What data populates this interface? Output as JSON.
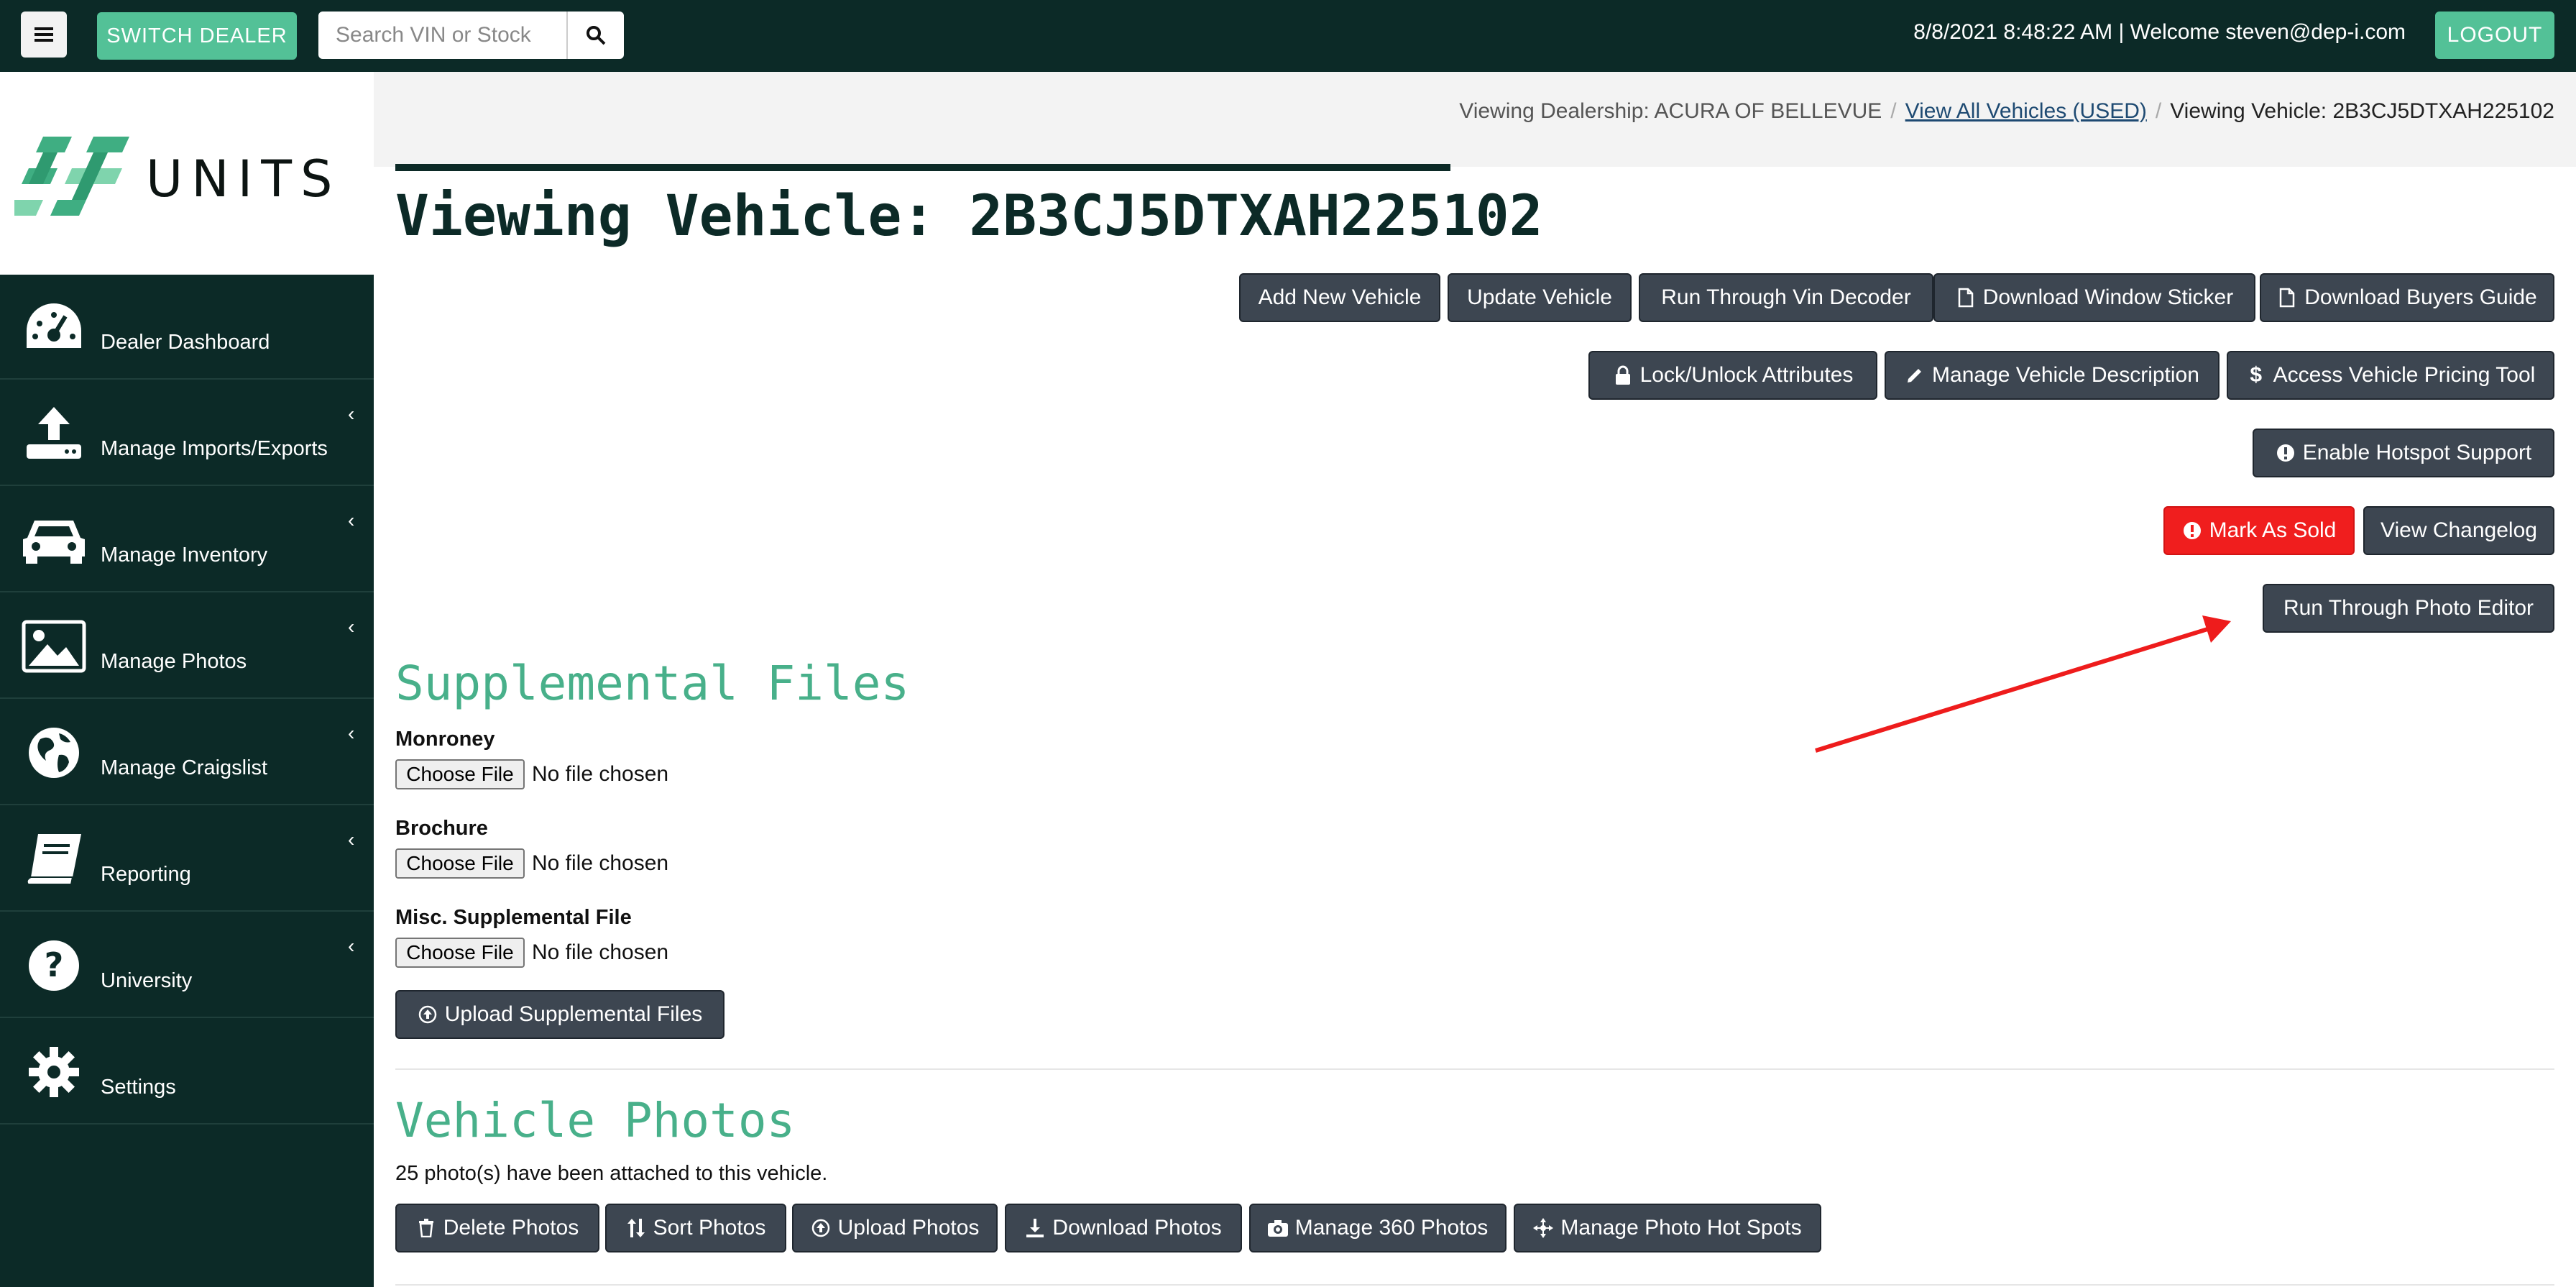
{
  "topbar": {
    "switch_dealer": "SWITCH DEALER",
    "search_placeholder": "Search VIN or Stock",
    "welcome": "8/8/2021 8:48:22 AM | Welcome steven@dep-i.com",
    "logout": "LOGOUT"
  },
  "brand": {
    "logo_text": "UNITS",
    "colors": {
      "dark": "#0c2a27",
      "accent": "#53c197",
      "danger": "#f01e1e",
      "button": "#3d4651"
    }
  },
  "sidebar": {
    "items": [
      {
        "label": "Dealer Dashboard",
        "icon": "dashboard-gauge-icon"
      },
      {
        "label": "Manage Imports/Exports",
        "icon": "upload-icon"
      },
      {
        "label": "Manage Inventory",
        "icon": "car-icon"
      },
      {
        "label": "Manage Photos",
        "icon": "image-icon"
      },
      {
        "label": "Manage Craigslist",
        "icon": "globe-icon"
      },
      {
        "label": "Reporting",
        "icon": "book-icon"
      },
      {
        "label": "University",
        "icon": "question-circle-icon"
      },
      {
        "label": "Settings",
        "icon": "gear-icon"
      }
    ]
  },
  "breadcrumb": {
    "dealership": "Viewing Dealership: ACURA OF BELLEVUE",
    "all_vehicles": "View All Vehicles (USED)",
    "current": "Viewing Vehicle: 2B3CJ5DTXAH225102"
  },
  "page_title": "Viewing Vehicle: 2B3CJ5DTXAH225102",
  "actions": {
    "add_new_vehicle": "Add New Vehicle",
    "update_vehicle": "Update Vehicle",
    "run_vin_decoder": "Run Through Vin Decoder",
    "download_window_sticker": "Download Window Sticker",
    "download_buyers_guide": "Download Buyers Guide",
    "lock_unlock": "Lock/Unlock Attributes",
    "manage_description": "Manage Vehicle Description",
    "pricing_tool": "Access Vehicle Pricing Tool",
    "hotspot_support": "Enable Hotspot Support",
    "mark_sold": "Mark As Sold",
    "view_changelog": "View Changelog",
    "photo_editor": "Run Through Photo Editor"
  },
  "supplemental": {
    "title": "Supplemental Files",
    "choose_file": "Choose File",
    "no_file": "No file chosen",
    "fields": [
      "Monroney",
      "Brochure",
      "Misc. Supplemental File"
    ],
    "upload": "Upload Supplemental Files"
  },
  "photos": {
    "title": "Vehicle Photos",
    "note": "25 photo(s) have been attached to this vehicle.",
    "delete": "Delete Photos",
    "sort": "Sort Photos",
    "upload": "Upload Photos",
    "download": "Download Photos",
    "manage_360": "Manage 360 Photos",
    "hot_spots": "Manage Photo Hot Spots"
  }
}
